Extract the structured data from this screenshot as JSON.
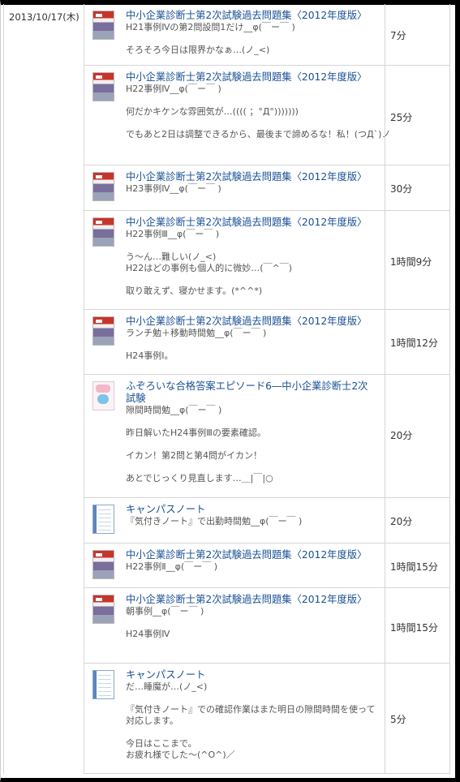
{
  "date": "2013/10/17(木)",
  "entries": [
    {
      "title": "中小企業診断士第2次試験過去問題集〈2012年度版〉",
      "lines": [
        "H21事例Ⅳの第2問設問1だけ__φ(￣ー￣ )",
        "",
        "そろそろ今日は限界かなぁ…(ノ_<)"
      ],
      "time": "7分",
      "thumb": "book-icon"
    },
    {
      "title": "中小企業診断士第2次試験過去問題集〈2012年度版〉",
      "lines": [
        "H22事例Ⅳ__φ(￣ー￣ )",
        "",
        "何だかキケンな雰囲気が…(((( ；°Д°)))))))",
        "",
        "でもあと2日は調整できるから、最後まで諦めるな！私！(つД`)ノ"
      ],
      "time": "25分",
      "thumb": "book-icon"
    },
    {
      "title": "中小企業診断士第2次試験過去問題集〈2012年度版〉",
      "lines": [
        "H23事例Ⅳ__φ(￣ー￣ )"
      ],
      "time": "30分",
      "thumb": "book-icon"
    },
    {
      "title": "中小企業診断士第2次試験過去問題集〈2012年度版〉",
      "lines": [
        "H22事例Ⅲ__φ(￣ー￣ )",
        "",
        "う〜ん…難しい(ノ_<)",
        "H22はどの事例も個人的に微妙…(￣^￣)",
        "",
        "取り敢えず、寝かせます。(*^^*)"
      ],
      "time": "1時間9分",
      "thumb": "book-icon"
    },
    {
      "title": "中小企業診断士第2次試験過去問題集〈2012年度版〉",
      "lines": [
        "ランチ勉＋移動時間勉__φ(￣ー￣ )",
        "",
        "H24事例Ⅰ。"
      ],
      "time": "1時間12分",
      "thumb": "book-icon"
    },
    {
      "title": "ふぞろいな合格答案エピソード6―中小企業診断士2次試験",
      "lines": [
        "隙間時間勉__φ(￣ー￣ )",
        "",
        "昨日解いたH24事例Ⅲの要素確認。",
        "",
        "イカン！第2問と第4問がイカン！",
        "",
        "あとでじっくり見直します…＿|￣|○"
      ],
      "time": "20分",
      "thumb": "manga-cover-icon"
    },
    {
      "title": "キャンパスノート",
      "lines": [
        "『気付きノート』で出勤時間勉__φ(￣ー￣ )"
      ],
      "time": "20分",
      "thumb": "notebook-icon"
    },
    {
      "title": "中小企業診断士第2次試験過去問題集〈2012年度版〉",
      "lines": [
        "H22事例Ⅱ__φ(￣ー￣ )"
      ],
      "time": "1時間15分",
      "thumb": "book-icon"
    },
    {
      "title": "中小企業診断士第2次試験過去問題集〈2012年度版〉",
      "lines": [
        "朝事例__φ(￣ー￣ )",
        "",
        "H24事例Ⅳ"
      ],
      "time": "1時間15分",
      "thumb": "book-icon"
    },
    {
      "title": "キャンパスノート",
      "lines": [
        "だ…睡魔が…(ノ_<)",
        "",
        "『気付きノート』での確認作業はまた明日の隙間時間を使って",
        "対応します。",
        "",
        "今日はここまで。",
        "お疲れ様でした〜(^O^)／"
      ],
      "time": "5分",
      "thumb": "notebook-icon"
    }
  ]
}
